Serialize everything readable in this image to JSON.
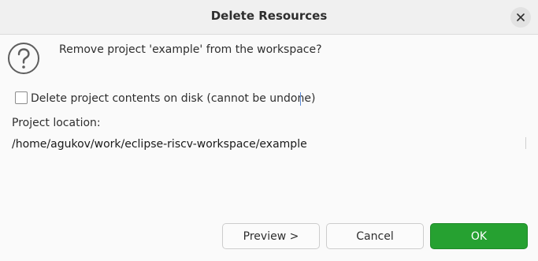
{
  "window": {
    "title": "Delete Resources",
    "close_icon": "close-icon"
  },
  "message": {
    "icon": "question-icon",
    "text": "Remove project 'example' from the workspace?"
  },
  "options": {
    "delete_contents_label": "Delete project contents on disk (cannot be undone)",
    "delete_contents_checked": false
  },
  "location": {
    "label": "Project location:",
    "value": "/home/agukov/work/eclipse-riscv-workspace/example"
  },
  "buttons": {
    "preview": "Preview >",
    "cancel": "Cancel",
    "ok": "OK"
  },
  "colors": {
    "ok_accent": "#26a131"
  }
}
